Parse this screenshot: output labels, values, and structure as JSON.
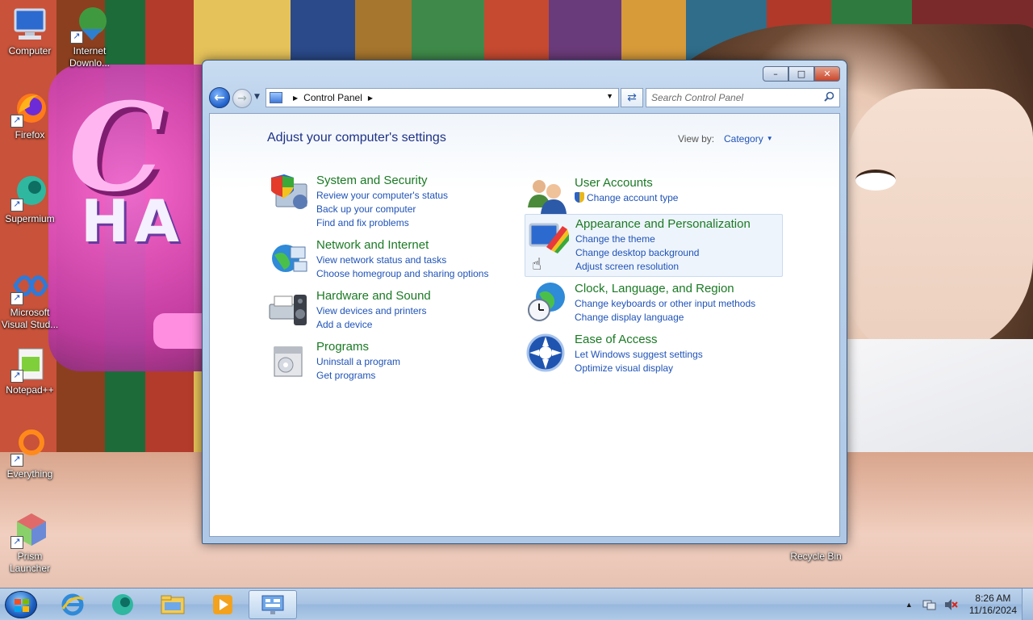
{
  "desktop": {
    "icons": [
      {
        "label": "Computer"
      },
      {
        "label": "Internet Downlo..."
      },
      {
        "label": "Firefox"
      },
      {
        "label": "Supermium"
      },
      {
        "label": "Microsoft Visual Stud..."
      },
      {
        "label": "Notepad++"
      },
      {
        "label": "Everything"
      },
      {
        "label": "Prism Launcher"
      },
      {
        "label": "Recycle Bin"
      }
    ]
  },
  "window": {
    "address": {
      "crumb": "Control Panel"
    },
    "search": {
      "placeholder": "Search Control Panel"
    },
    "page_title": "Adjust your computer's settings",
    "view_by": {
      "label": "View by:",
      "value": "Category"
    },
    "categories": [
      {
        "heading": "System and Security",
        "links": [
          "Review your computer's status",
          "Back up your computer",
          "Find and fix problems"
        ],
        "icon": "shield-computer-icon"
      },
      {
        "heading": "Network and Internet",
        "links": [
          "View network status and tasks",
          "Choose homegroup and sharing options"
        ],
        "icon": "network-globe-icon"
      },
      {
        "heading": "Hardware and Sound",
        "links": [
          "View devices and printers",
          "Add a device"
        ],
        "icon": "printer-speaker-icon"
      },
      {
        "heading": "Programs",
        "links": [
          "Uninstall a program",
          "Get programs"
        ],
        "icon": "programs-box-icon"
      },
      {
        "heading": "User Accounts",
        "links": [
          "Change account type"
        ],
        "icon": "users-icon"
      },
      {
        "heading": "Appearance and Personalization",
        "links": [
          "Change the theme",
          "Change desktop background",
          "Adjust screen resolution"
        ],
        "icon": "monitor-colors-icon"
      },
      {
        "heading": "Clock, Language, and Region",
        "links": [
          "Change keyboards or other input methods",
          "Change display language"
        ],
        "icon": "clock-globe-icon"
      },
      {
        "heading": "Ease of Access",
        "links": [
          "Let Windows suggest settings",
          "Optimize visual display"
        ],
        "icon": "ease-of-access-icon"
      }
    ]
  },
  "taskbar": {
    "pinned": [
      "internet-explorer-icon",
      "supermium-icon",
      "file-explorer-icon",
      "media-player-icon",
      "control-panel-icon"
    ],
    "clock": {
      "time": "8:26 AM",
      "date": "11/16/2024"
    }
  },
  "colors": {
    "link": "#1f53b8",
    "category_heading": "#1a7a24",
    "title": "#1e3287"
  }
}
